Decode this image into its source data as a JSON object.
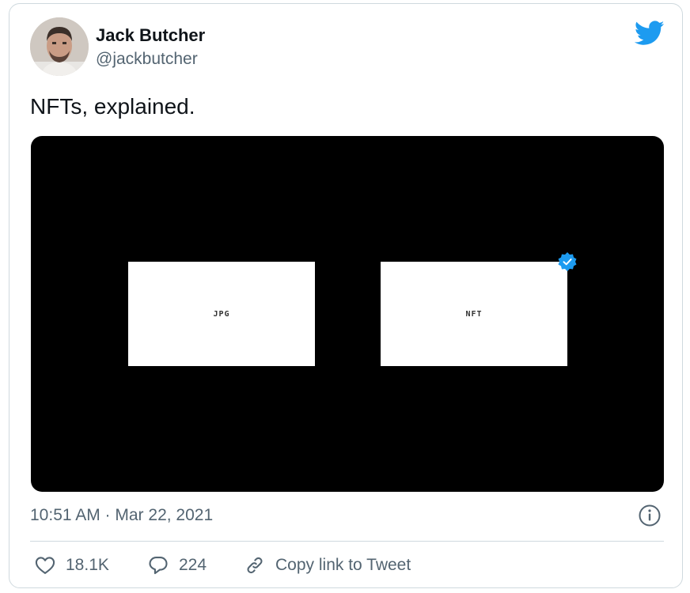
{
  "tweet": {
    "author_name": "Jack Butcher",
    "author_handle": "@jackbutcher",
    "text": "NFTs, explained.",
    "media": {
      "left_label": "JPG",
      "right_label": "NFT"
    },
    "timestamp": "10:51 AM · Mar 22, 2021",
    "likes": "18.1K",
    "replies": "224",
    "copy_link_label": "Copy link to Tweet"
  },
  "icons": {
    "brand": "twitter-bird-icon",
    "verified": "verified-badge-icon",
    "info": "info-icon",
    "like": "heart-icon",
    "reply": "reply-bubble-icon",
    "link": "link-icon"
  },
  "colors": {
    "twitter_blue": "#1d9bf0",
    "text_secondary": "#536471",
    "media_background": "#000000"
  }
}
